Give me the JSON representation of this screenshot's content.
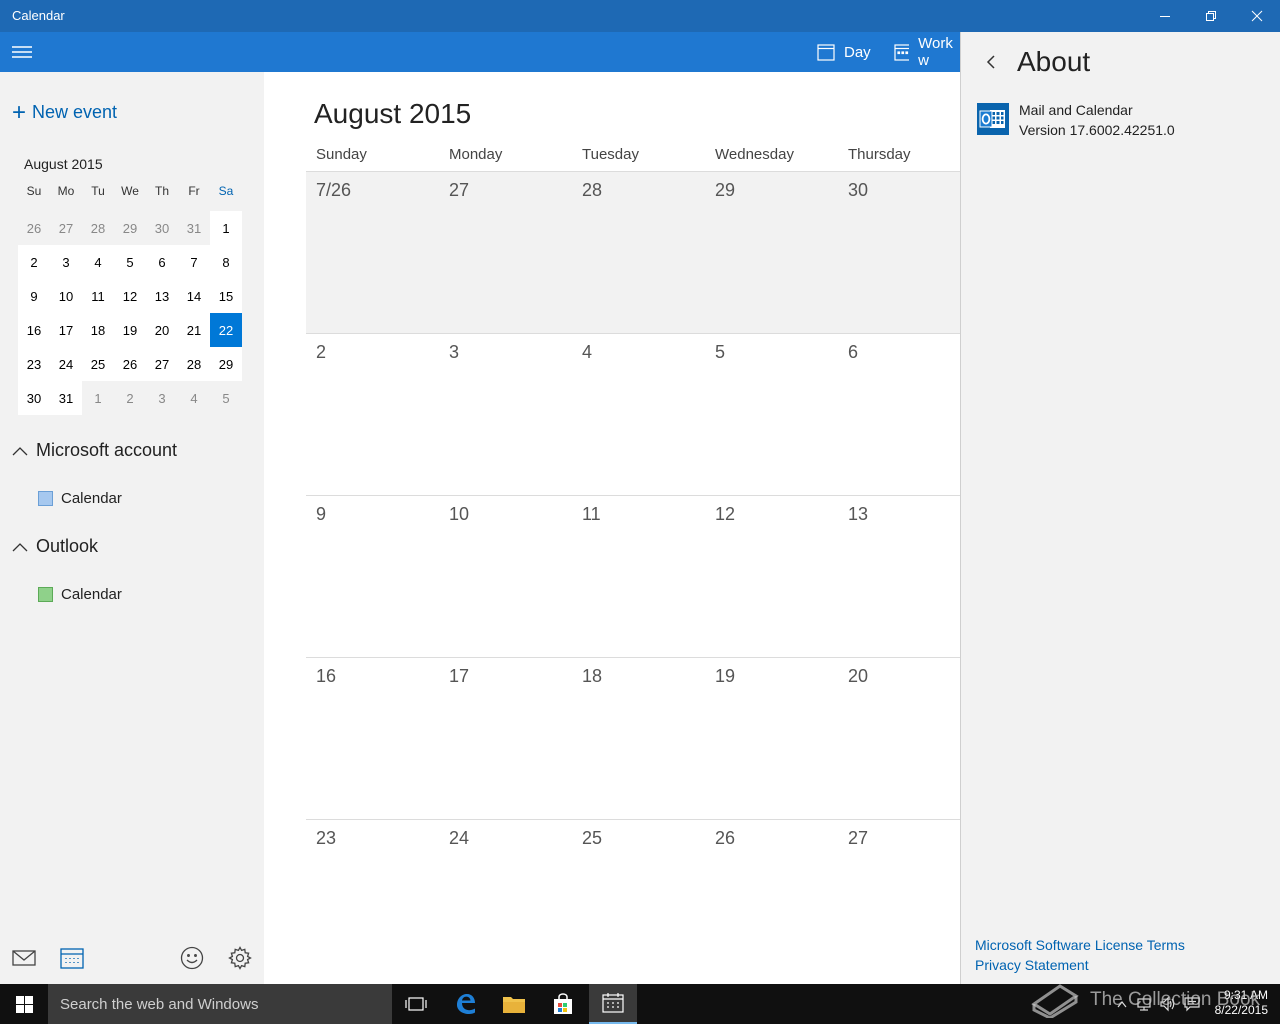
{
  "window": {
    "title": "Calendar"
  },
  "toolbar": {
    "day_label": "Day",
    "work_week_label": "Work w"
  },
  "sidebar": {
    "new_event_label": "New event",
    "mini_calendar": {
      "month_label": "August 2015",
      "dow": [
        "Su",
        "Mo",
        "Tu",
        "We",
        "Th",
        "Fr",
        "Sa"
      ],
      "weeks": [
        [
          "26",
          "27",
          "28",
          "29",
          "30",
          "31",
          "1"
        ],
        [
          "2",
          "3",
          "4",
          "5",
          "6",
          "7",
          "8"
        ],
        [
          "9",
          "10",
          "11",
          "12",
          "13",
          "14",
          "15"
        ],
        [
          "16",
          "17",
          "18",
          "19",
          "20",
          "21",
          "22"
        ],
        [
          "23",
          "24",
          "25",
          "26",
          "27",
          "28",
          "29"
        ],
        [
          "30",
          "31",
          "1",
          "2",
          "3",
          "4",
          "5"
        ]
      ],
      "today": "22"
    },
    "accounts": [
      {
        "name": "Microsoft account",
        "calendar_label": "Calendar",
        "color": "#a6c8ef"
      },
      {
        "name": "Outlook",
        "calendar_label": "Calendar",
        "color": "#8fd18a"
      }
    ]
  },
  "main": {
    "month_title": "August 2015",
    "day_headers": [
      "Sunday",
      "Monday",
      "Tuesday",
      "Wednesday",
      "Thursday"
    ],
    "weeks": [
      [
        "7/26",
        "27",
        "28",
        "29",
        "30"
      ],
      [
        "2",
        "3",
        "4",
        "5",
        "6"
      ],
      [
        "9",
        "10",
        "11",
        "12",
        "13"
      ],
      [
        "16",
        "17",
        "18",
        "19",
        "20"
      ],
      [
        "23",
        "24",
        "25",
        "26",
        "27"
      ]
    ]
  },
  "about": {
    "heading": "About",
    "app_name": "Mail and Calendar",
    "version": "Version 17.6002.42251.0",
    "license_link": "Microsoft Software License Terms",
    "privacy_link": "Privacy Statement"
  },
  "taskbar": {
    "search_placeholder": "Search the web and Windows",
    "time": "9:31 AM",
    "date": "8/22/2015"
  },
  "watermark": {
    "text": "The Collection Book"
  },
  "colors": {
    "titlebar": "#1e69b4",
    "appbar": "#1f78d1",
    "accent": "#0078d7",
    "link": "#0063b1"
  }
}
